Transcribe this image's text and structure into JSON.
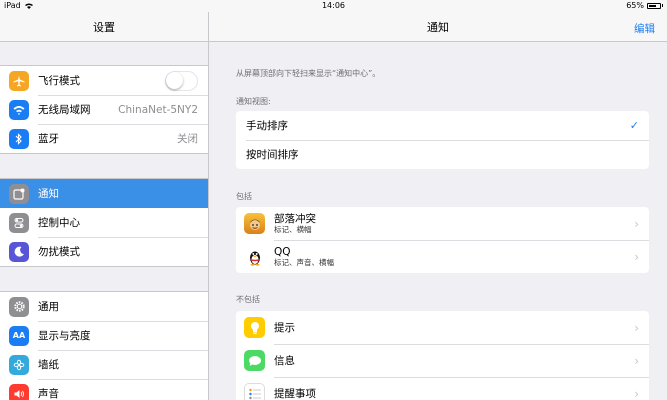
{
  "status_bar": {
    "device": "iPad",
    "time": "14:06",
    "battery": "65%"
  },
  "left": {
    "title": "设置",
    "groups": [
      [
        {
          "label": "飞行模式",
          "icon": "airplane-icon",
          "color": "#f5a623",
          "type": "switch"
        },
        {
          "label": "无线局域网",
          "icon": "wifi-icon",
          "color": "#1a7df4",
          "detail": "ChinaNet-5NY2"
        },
        {
          "label": "蓝牙",
          "icon": "bluetooth-icon",
          "color": "#1a7df4",
          "detail": "关闭"
        }
      ],
      [
        {
          "label": "通知",
          "icon": "notifications-icon",
          "color": "#8e8e93",
          "selected": true
        },
        {
          "label": "控制中心",
          "icon": "control-center-icon",
          "color": "#8e8e93"
        },
        {
          "label": "勿扰模式",
          "icon": "moon-icon",
          "color": "#5856d6"
        }
      ],
      [
        {
          "label": "通用",
          "icon": "gear-icon",
          "color": "#8e8e93"
        },
        {
          "label": "显示与亮度",
          "icon": "display-icon",
          "color": "#1a7df4"
        },
        {
          "label": "墙纸",
          "icon": "wallpaper-icon",
          "color": "#34aadc"
        },
        {
          "label": "声音",
          "icon": "sound-icon",
          "color": "#ff3b30"
        }
      ]
    ]
  },
  "right": {
    "title": "通知",
    "edit_label": "编辑",
    "hint": "从屏幕顶部向下轻扫来显示“通知中心”。",
    "view_header": "通知视图:",
    "sort_options": [
      {
        "label": "手动排序",
        "checked": true
      },
      {
        "label": "按时间排序",
        "checked": false
      }
    ],
    "include_header": "包括",
    "include": [
      {
        "name": "部落冲突",
        "sub": "标记、横幅",
        "icon": "clash-of-clans-icon",
        "color": "#f0a31a"
      },
      {
        "name": "QQ",
        "sub": "标记、声音、横幅",
        "icon": "qq-penguin-icon",
        "color": "#ffffff"
      }
    ],
    "exclude_header": "不包括",
    "exclude": [
      {
        "name": "提示",
        "icon": "tips-bulb-icon",
        "color": "#ffcc00"
      },
      {
        "name": "信息",
        "icon": "messages-icon",
        "color": "#4cd964"
      },
      {
        "name": "提醒事项",
        "icon": "reminders-icon",
        "color": "#ffffff"
      }
    ]
  }
}
